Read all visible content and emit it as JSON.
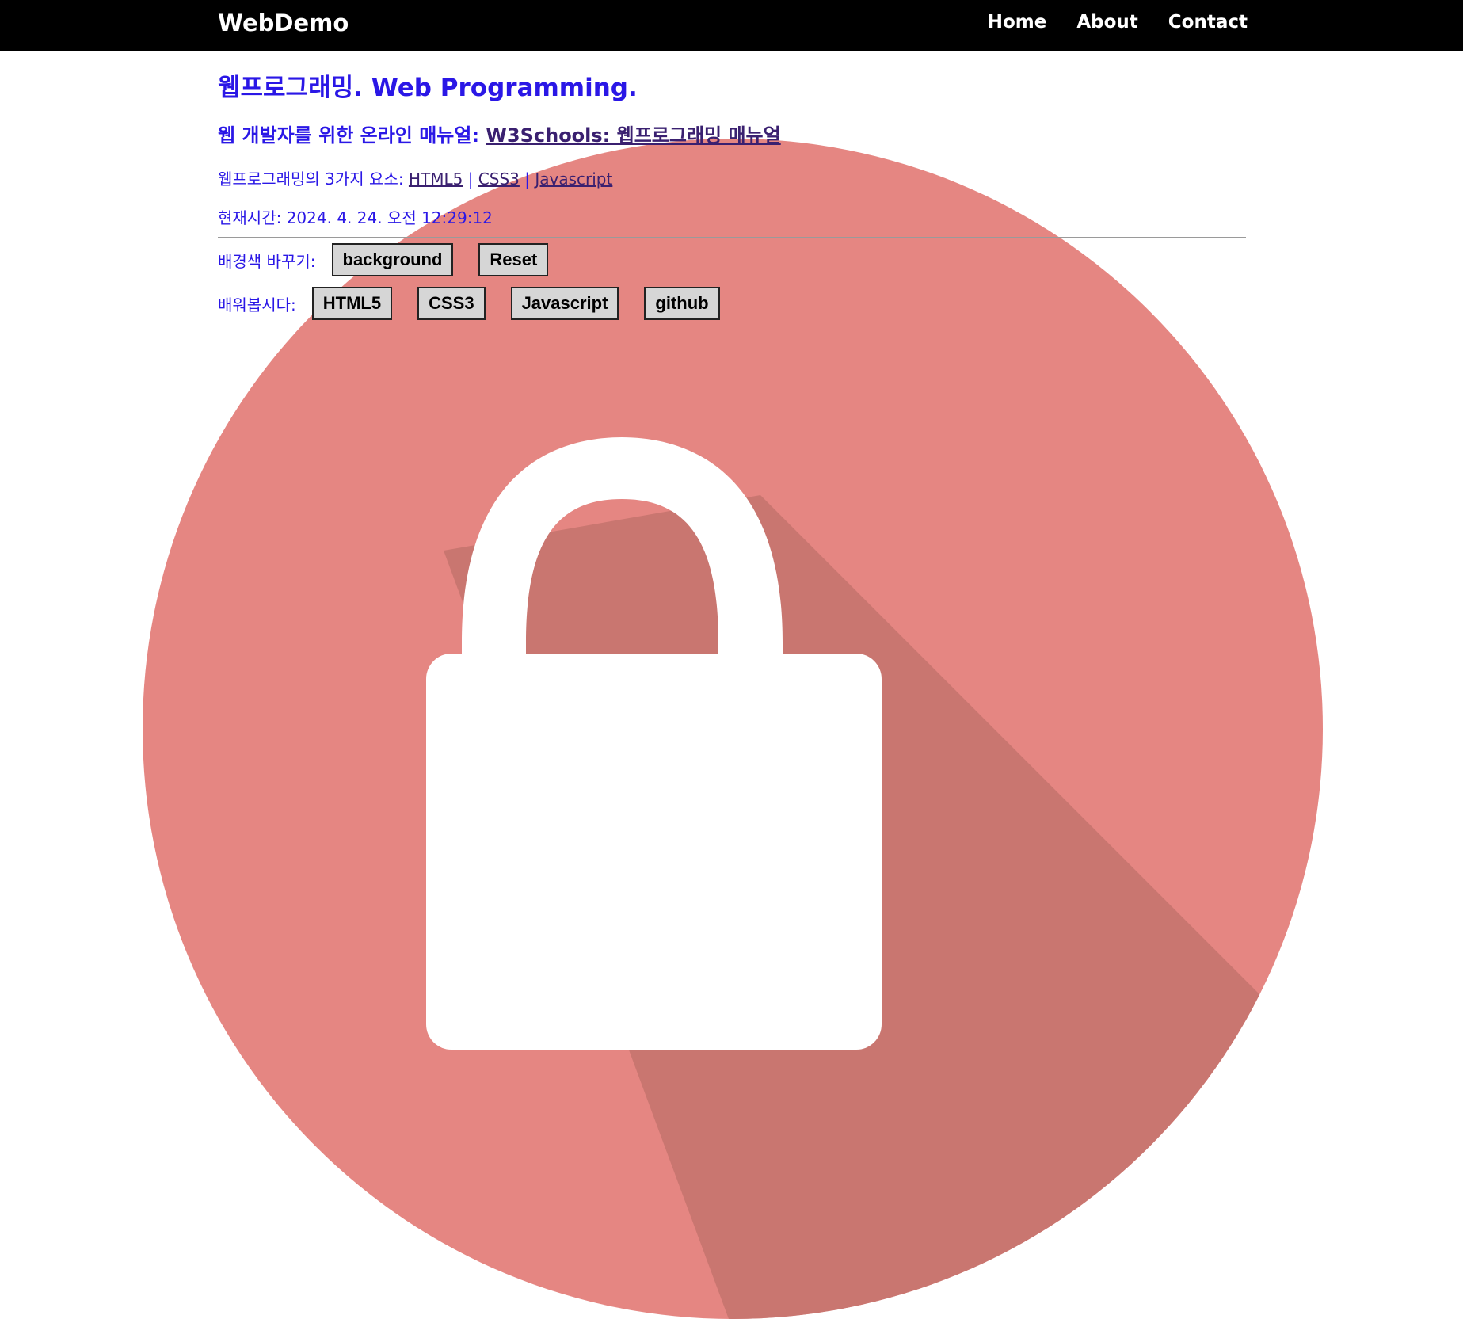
{
  "header": {
    "brand": "WebDemo",
    "nav": [
      "Home",
      "About",
      "Contact"
    ]
  },
  "main": {
    "title": "웹프로그래밍. Web Programming.",
    "subtitle_prefix": "웹 개발자를 위한 온라인 매뉴얼: ",
    "subtitle_link": "W3Schools: 웹프로그래밍 매뉴얼",
    "elements_prefix": "웹프로그래밍의 3가지 요소: ",
    "elements_links": [
      "HTML5",
      "CSS3",
      "Javascript"
    ],
    "elements_separator": "|",
    "time_label": "현재시간: ",
    "time_value": "2024. 4. 24. 오전 12:29:12",
    "bg_label": "배경색 바꾸기:",
    "bg_buttons": [
      "background",
      "Reset"
    ],
    "learn_label": "배워봅시다:",
    "learn_buttons": [
      "HTML5",
      "CSS3",
      "Javascript",
      "github"
    ]
  },
  "colors": {
    "text_accent": "#2a17e6",
    "header_bg": "#000000",
    "circle": "#e58682",
    "circle_shadow": "#c97670",
    "lock": "#ffffff"
  },
  "icons": {
    "hero": "lock-icon"
  }
}
